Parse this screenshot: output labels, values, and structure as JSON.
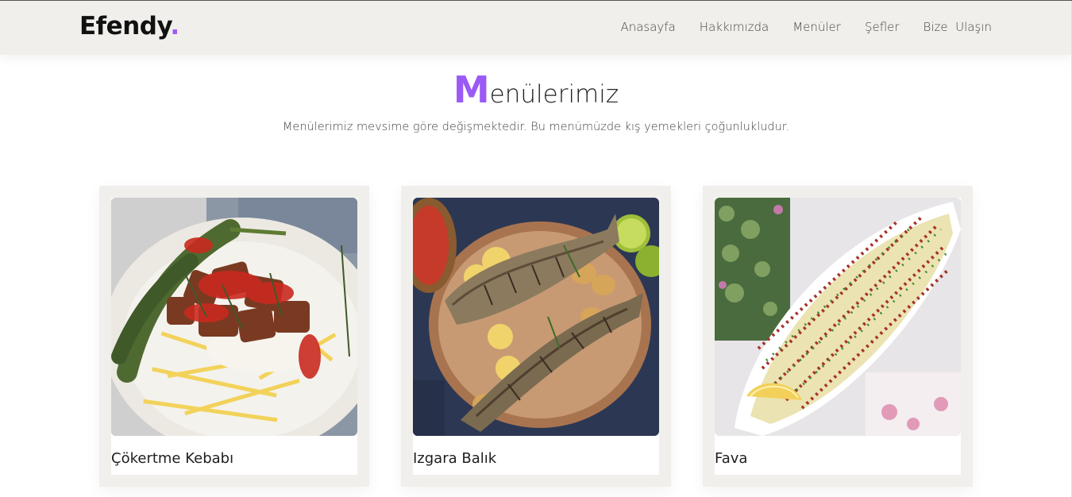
{
  "header": {
    "logo": "Efendy",
    "logo_dot": ".",
    "nav": [
      "Anasayfa",
      "Hakkımızda",
      "Menüler",
      "Şefler",
      "Bize  Ulaşın"
    ]
  },
  "menus": {
    "title_initial": "M",
    "title_rest": "enülerimiz",
    "subtitle": "Menülerimiz mevsime göre değişmektedir. Bu menümüzde kış yemekleri çoğunlukludur.",
    "items": [
      {
        "name": "Çökertme Kebabı"
      },
      {
        "name": "Izgara Balık"
      },
      {
        "name": "Fava"
      }
    ]
  },
  "colors": {
    "accent": "#9b59f5",
    "navbar_bg": "#f0efeb",
    "card_bg": "#f0efeb"
  }
}
